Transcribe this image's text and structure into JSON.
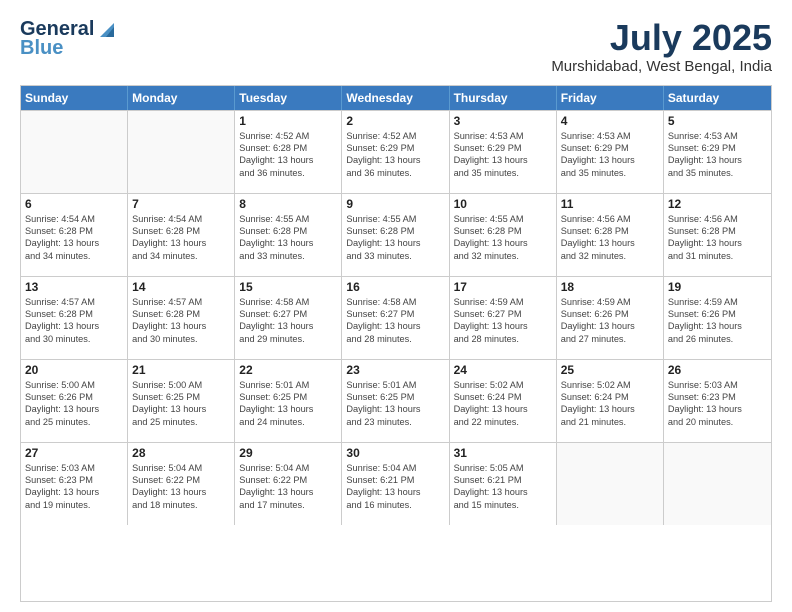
{
  "logo": {
    "line1": "General",
    "line2": "Blue"
  },
  "title": "July 2025",
  "subtitle": "Murshidabad, West Bengal, India",
  "weekdays": [
    "Sunday",
    "Monday",
    "Tuesday",
    "Wednesday",
    "Thursday",
    "Friday",
    "Saturday"
  ],
  "rows": [
    [
      {
        "day": "",
        "lines": []
      },
      {
        "day": "",
        "lines": []
      },
      {
        "day": "1",
        "lines": [
          "Sunrise: 4:52 AM",
          "Sunset: 6:28 PM",
          "Daylight: 13 hours",
          "and 36 minutes."
        ]
      },
      {
        "day": "2",
        "lines": [
          "Sunrise: 4:52 AM",
          "Sunset: 6:29 PM",
          "Daylight: 13 hours",
          "and 36 minutes."
        ]
      },
      {
        "day": "3",
        "lines": [
          "Sunrise: 4:53 AM",
          "Sunset: 6:29 PM",
          "Daylight: 13 hours",
          "and 35 minutes."
        ]
      },
      {
        "day": "4",
        "lines": [
          "Sunrise: 4:53 AM",
          "Sunset: 6:29 PM",
          "Daylight: 13 hours",
          "and 35 minutes."
        ]
      },
      {
        "day": "5",
        "lines": [
          "Sunrise: 4:53 AM",
          "Sunset: 6:29 PM",
          "Daylight: 13 hours",
          "and 35 minutes."
        ]
      }
    ],
    [
      {
        "day": "6",
        "lines": [
          "Sunrise: 4:54 AM",
          "Sunset: 6:28 PM",
          "Daylight: 13 hours",
          "and 34 minutes."
        ]
      },
      {
        "day": "7",
        "lines": [
          "Sunrise: 4:54 AM",
          "Sunset: 6:28 PM",
          "Daylight: 13 hours",
          "and 34 minutes."
        ]
      },
      {
        "day": "8",
        "lines": [
          "Sunrise: 4:55 AM",
          "Sunset: 6:28 PM",
          "Daylight: 13 hours",
          "and 33 minutes."
        ]
      },
      {
        "day": "9",
        "lines": [
          "Sunrise: 4:55 AM",
          "Sunset: 6:28 PM",
          "Daylight: 13 hours",
          "and 33 minutes."
        ]
      },
      {
        "day": "10",
        "lines": [
          "Sunrise: 4:55 AM",
          "Sunset: 6:28 PM",
          "Daylight: 13 hours",
          "and 32 minutes."
        ]
      },
      {
        "day": "11",
        "lines": [
          "Sunrise: 4:56 AM",
          "Sunset: 6:28 PM",
          "Daylight: 13 hours",
          "and 32 minutes."
        ]
      },
      {
        "day": "12",
        "lines": [
          "Sunrise: 4:56 AM",
          "Sunset: 6:28 PM",
          "Daylight: 13 hours",
          "and 31 minutes."
        ]
      }
    ],
    [
      {
        "day": "13",
        "lines": [
          "Sunrise: 4:57 AM",
          "Sunset: 6:28 PM",
          "Daylight: 13 hours",
          "and 30 minutes."
        ]
      },
      {
        "day": "14",
        "lines": [
          "Sunrise: 4:57 AM",
          "Sunset: 6:28 PM",
          "Daylight: 13 hours",
          "and 30 minutes."
        ]
      },
      {
        "day": "15",
        "lines": [
          "Sunrise: 4:58 AM",
          "Sunset: 6:27 PM",
          "Daylight: 13 hours",
          "and 29 minutes."
        ]
      },
      {
        "day": "16",
        "lines": [
          "Sunrise: 4:58 AM",
          "Sunset: 6:27 PM",
          "Daylight: 13 hours",
          "and 28 minutes."
        ]
      },
      {
        "day": "17",
        "lines": [
          "Sunrise: 4:59 AM",
          "Sunset: 6:27 PM",
          "Daylight: 13 hours",
          "and 28 minutes."
        ]
      },
      {
        "day": "18",
        "lines": [
          "Sunrise: 4:59 AM",
          "Sunset: 6:26 PM",
          "Daylight: 13 hours",
          "and 27 minutes."
        ]
      },
      {
        "day": "19",
        "lines": [
          "Sunrise: 4:59 AM",
          "Sunset: 6:26 PM",
          "Daylight: 13 hours",
          "and 26 minutes."
        ]
      }
    ],
    [
      {
        "day": "20",
        "lines": [
          "Sunrise: 5:00 AM",
          "Sunset: 6:26 PM",
          "Daylight: 13 hours",
          "and 25 minutes."
        ]
      },
      {
        "day": "21",
        "lines": [
          "Sunrise: 5:00 AM",
          "Sunset: 6:25 PM",
          "Daylight: 13 hours",
          "and 25 minutes."
        ]
      },
      {
        "day": "22",
        "lines": [
          "Sunrise: 5:01 AM",
          "Sunset: 6:25 PM",
          "Daylight: 13 hours",
          "and 24 minutes."
        ]
      },
      {
        "day": "23",
        "lines": [
          "Sunrise: 5:01 AM",
          "Sunset: 6:25 PM",
          "Daylight: 13 hours",
          "and 23 minutes."
        ]
      },
      {
        "day": "24",
        "lines": [
          "Sunrise: 5:02 AM",
          "Sunset: 6:24 PM",
          "Daylight: 13 hours",
          "and 22 minutes."
        ]
      },
      {
        "day": "25",
        "lines": [
          "Sunrise: 5:02 AM",
          "Sunset: 6:24 PM",
          "Daylight: 13 hours",
          "and 21 minutes."
        ]
      },
      {
        "day": "26",
        "lines": [
          "Sunrise: 5:03 AM",
          "Sunset: 6:23 PM",
          "Daylight: 13 hours",
          "and 20 minutes."
        ]
      }
    ],
    [
      {
        "day": "27",
        "lines": [
          "Sunrise: 5:03 AM",
          "Sunset: 6:23 PM",
          "Daylight: 13 hours",
          "and 19 minutes."
        ]
      },
      {
        "day": "28",
        "lines": [
          "Sunrise: 5:04 AM",
          "Sunset: 6:22 PM",
          "Daylight: 13 hours",
          "and 18 minutes."
        ]
      },
      {
        "day": "29",
        "lines": [
          "Sunrise: 5:04 AM",
          "Sunset: 6:22 PM",
          "Daylight: 13 hours",
          "and 17 minutes."
        ]
      },
      {
        "day": "30",
        "lines": [
          "Sunrise: 5:04 AM",
          "Sunset: 6:21 PM",
          "Daylight: 13 hours",
          "and 16 minutes."
        ]
      },
      {
        "day": "31",
        "lines": [
          "Sunrise: 5:05 AM",
          "Sunset: 6:21 PM",
          "Daylight: 13 hours",
          "and 15 minutes."
        ]
      },
      {
        "day": "",
        "lines": []
      },
      {
        "day": "",
        "lines": []
      }
    ]
  ]
}
